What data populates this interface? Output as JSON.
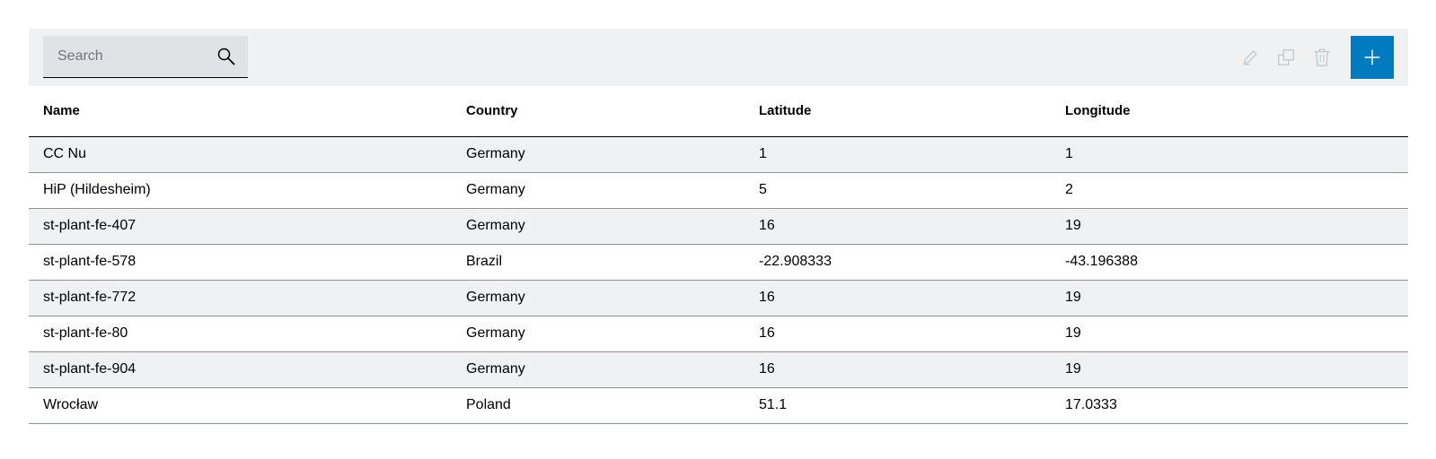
{
  "search": {
    "placeholder": "Search",
    "value": ""
  },
  "toolbar": {
    "icons": {
      "search": "search-icon",
      "edit": "edit-icon",
      "duplicate": "copy-icon",
      "delete": "delete-icon",
      "add": "plus-icon"
    },
    "accent_color": "#007bc0",
    "disabled_icon_color": "#c1c7cc"
  },
  "table": {
    "columns": [
      "Name",
      "Country",
      "Latitude",
      "Longitude"
    ],
    "rows": [
      [
        "CC Nu",
        "Germany",
        "1",
        "1"
      ],
      [
        "HiP (Hildesheim)",
        "Germany",
        "5",
        "2"
      ],
      [
        "st-plant-fe-407",
        "Germany",
        "16",
        "19"
      ],
      [
        "st-plant-fe-578",
        "Brazil",
        "-22.908333",
        "-43.196388"
      ],
      [
        "st-plant-fe-772",
        "Germany",
        "16",
        "19"
      ],
      [
        "st-plant-fe-80",
        "Germany",
        "16",
        "19"
      ],
      [
        "st-plant-fe-904",
        "Germany",
        "16",
        "19"
      ],
      [
        "Wrocław",
        "Poland",
        "51.1",
        "17.0333"
      ]
    ]
  }
}
